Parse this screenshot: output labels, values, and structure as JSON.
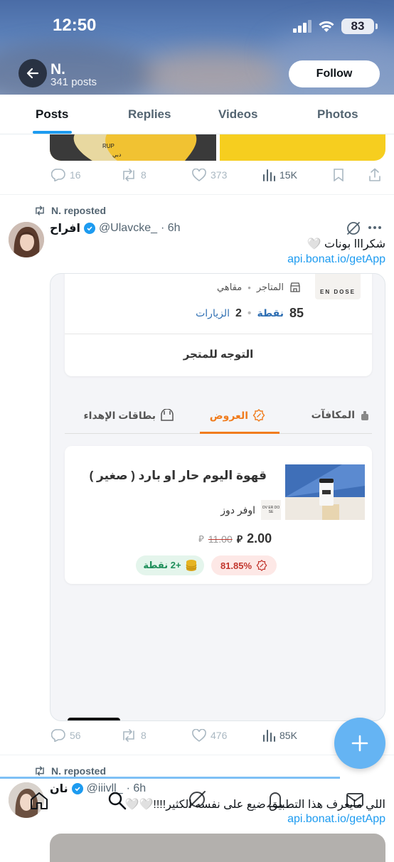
{
  "status_bar": {
    "time": "12:50",
    "battery": "83"
  },
  "header": {
    "name": "N.",
    "post_count": "341 posts",
    "follow_label": "Follow"
  },
  "tabs": [
    {
      "label": "Posts"
    },
    {
      "label": "Replies"
    },
    {
      "label": "Videos"
    },
    {
      "label": "Photos"
    }
  ],
  "prev_post": {
    "map_labels": [
      "RUP",
      "دبي"
    ],
    "actions": {
      "replies": "16",
      "reposts": "8",
      "likes": "373",
      "views": "15K"
    }
  },
  "post1": {
    "reposted_by": "N. reposted",
    "author_name": "افراح",
    "handle": "@Ulavcke_",
    "time": "· 6h",
    "text": "شكرااا بونات 🤍",
    "link": "api.bonat.io/getApp",
    "card": {
      "store_logo": "EN DOSE",
      "category_label": "المتاجر",
      "category_value": "مقاهي",
      "visits_value": "2",
      "visits_label": "الزيارات",
      "points_value": "85",
      "points_label": "نقطة",
      "go_to_store": "التوجه للمتجر",
      "tabs": [
        "المكافآت",
        "العروض",
        "بطاقات الإهداء"
      ],
      "offer": {
        "title": "قهوة اليوم حار او بارد ( صغير )",
        "store_name": "اوفر دوز",
        "store_logo": "OV ER DO SE",
        "price": "2.00",
        "old_price": "11.00",
        "discount": "81.85%",
        "points": "+2 نقطة"
      }
    },
    "actions": {
      "replies": "56",
      "reposts": "8",
      "likes": "476",
      "views": "85K"
    }
  },
  "post2": {
    "reposted_by": "N. reposted",
    "author_name": "نان",
    "handle": "@iiivll_",
    "time": "· 6h",
    "text": "اللي مايعرف هذا التطبيق ضيع على نفسه الكثير!!!!🤍🤍",
    "link": "api.bonat.io/getApp"
  },
  "colors": {
    "accent": "#1d9bf0",
    "offer_orange": "#f07c1e",
    "discount_red": "#c2362d",
    "points_green": "#1e8e5a"
  }
}
